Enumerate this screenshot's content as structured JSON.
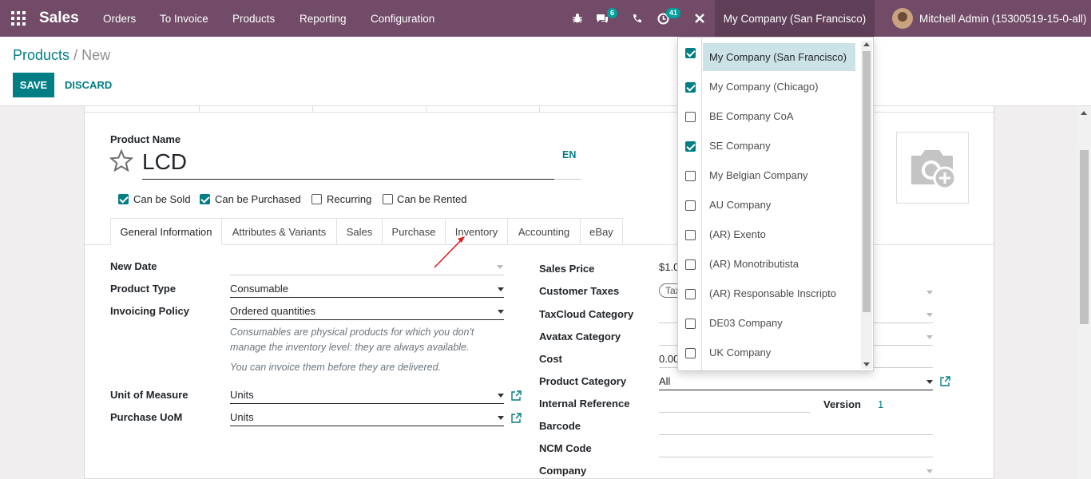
{
  "navbar": {
    "app_name": "Sales",
    "menu": [
      "Orders",
      "To Invoice",
      "Products",
      "Reporting",
      "Configuration"
    ],
    "messages_badge": "6",
    "activities_badge": "41",
    "company_switcher": "My Company (San Francisco)",
    "user": "Mitchell Admin (15300519-15-0-all)",
    "colors": {
      "bar": "#714b67",
      "accent": "#017e84",
      "badge": "#00a09d"
    }
  },
  "breadcrumb": {
    "parent": "Products",
    "separator": "/",
    "current": "New"
  },
  "buttons": {
    "save": "SAVE",
    "discard": "DISCARD"
  },
  "product": {
    "name_label": "Product Name",
    "name": "LCD",
    "lang": "EN",
    "checkboxes": [
      {
        "label": "Can be Sold",
        "checked": true
      },
      {
        "label": "Can be Purchased",
        "checked": true
      },
      {
        "label": "Recurring",
        "checked": false
      },
      {
        "label": "Can be Rented",
        "checked": false
      }
    ]
  },
  "tabs": [
    "General Information",
    "Attributes & Variants",
    "Sales",
    "Purchase",
    "Inventory",
    "Accounting",
    "eBay"
  ],
  "active_tab": "General Information",
  "left_fields": {
    "new_date": {
      "label": "New Date",
      "value": ""
    },
    "product_type": {
      "label": "Product Type",
      "value": "Consumable"
    },
    "invoicing_policy": {
      "label": "Invoicing Policy",
      "value": "Ordered quantities"
    },
    "help1": "Consumables are physical products for which you don't manage the inventory level: they are always available.",
    "help2": "You can invoice them before they are delivered.",
    "uom": {
      "label": "Unit of Measure",
      "value": "Units"
    },
    "purchase_uom": {
      "label": "Purchase UoM",
      "value": "Units"
    }
  },
  "right_fields": {
    "sales_price": {
      "label": "Sales Price",
      "value": "$1.0"
    },
    "customer_taxes": {
      "label": "Customer Taxes",
      "value": "Tax"
    },
    "taxcloud": {
      "label": "TaxCloud Category",
      "value": ""
    },
    "avatax": {
      "label": "Avatax Category",
      "value": ""
    },
    "cost": {
      "label": "Cost",
      "value": "0.00"
    },
    "category": {
      "label": "Product Category",
      "value": "All"
    },
    "internal_ref": {
      "label": "Internal Reference",
      "value": ""
    },
    "version": {
      "label": "Version",
      "value": "1"
    },
    "barcode": {
      "label": "Barcode",
      "value": ""
    },
    "ncm": {
      "label": "NCM Code",
      "value": ""
    },
    "company": {
      "label": "Company",
      "value": ""
    }
  },
  "company_dropdown": [
    {
      "name": "My Company (San Francisco)",
      "checked": true,
      "highlight": true
    },
    {
      "name": "My Company (Chicago)",
      "checked": true,
      "highlight": false
    },
    {
      "name": "BE Company CoA",
      "checked": false,
      "highlight": false
    },
    {
      "name": "SE Company",
      "checked": true,
      "highlight": false
    },
    {
      "name": "My Belgian Company",
      "checked": false,
      "highlight": false
    },
    {
      "name": "AU Company",
      "checked": false,
      "highlight": false
    },
    {
      "name": "(AR) Exento",
      "checked": false,
      "highlight": false
    },
    {
      "name": "(AR) Monotributista",
      "checked": false,
      "highlight": false
    },
    {
      "name": "(AR) Responsable Inscripto",
      "checked": false,
      "highlight": false
    },
    {
      "name": "DE03 Company",
      "checked": false,
      "highlight": false
    },
    {
      "name": "UK Company",
      "checked": false,
      "highlight": false
    }
  ]
}
